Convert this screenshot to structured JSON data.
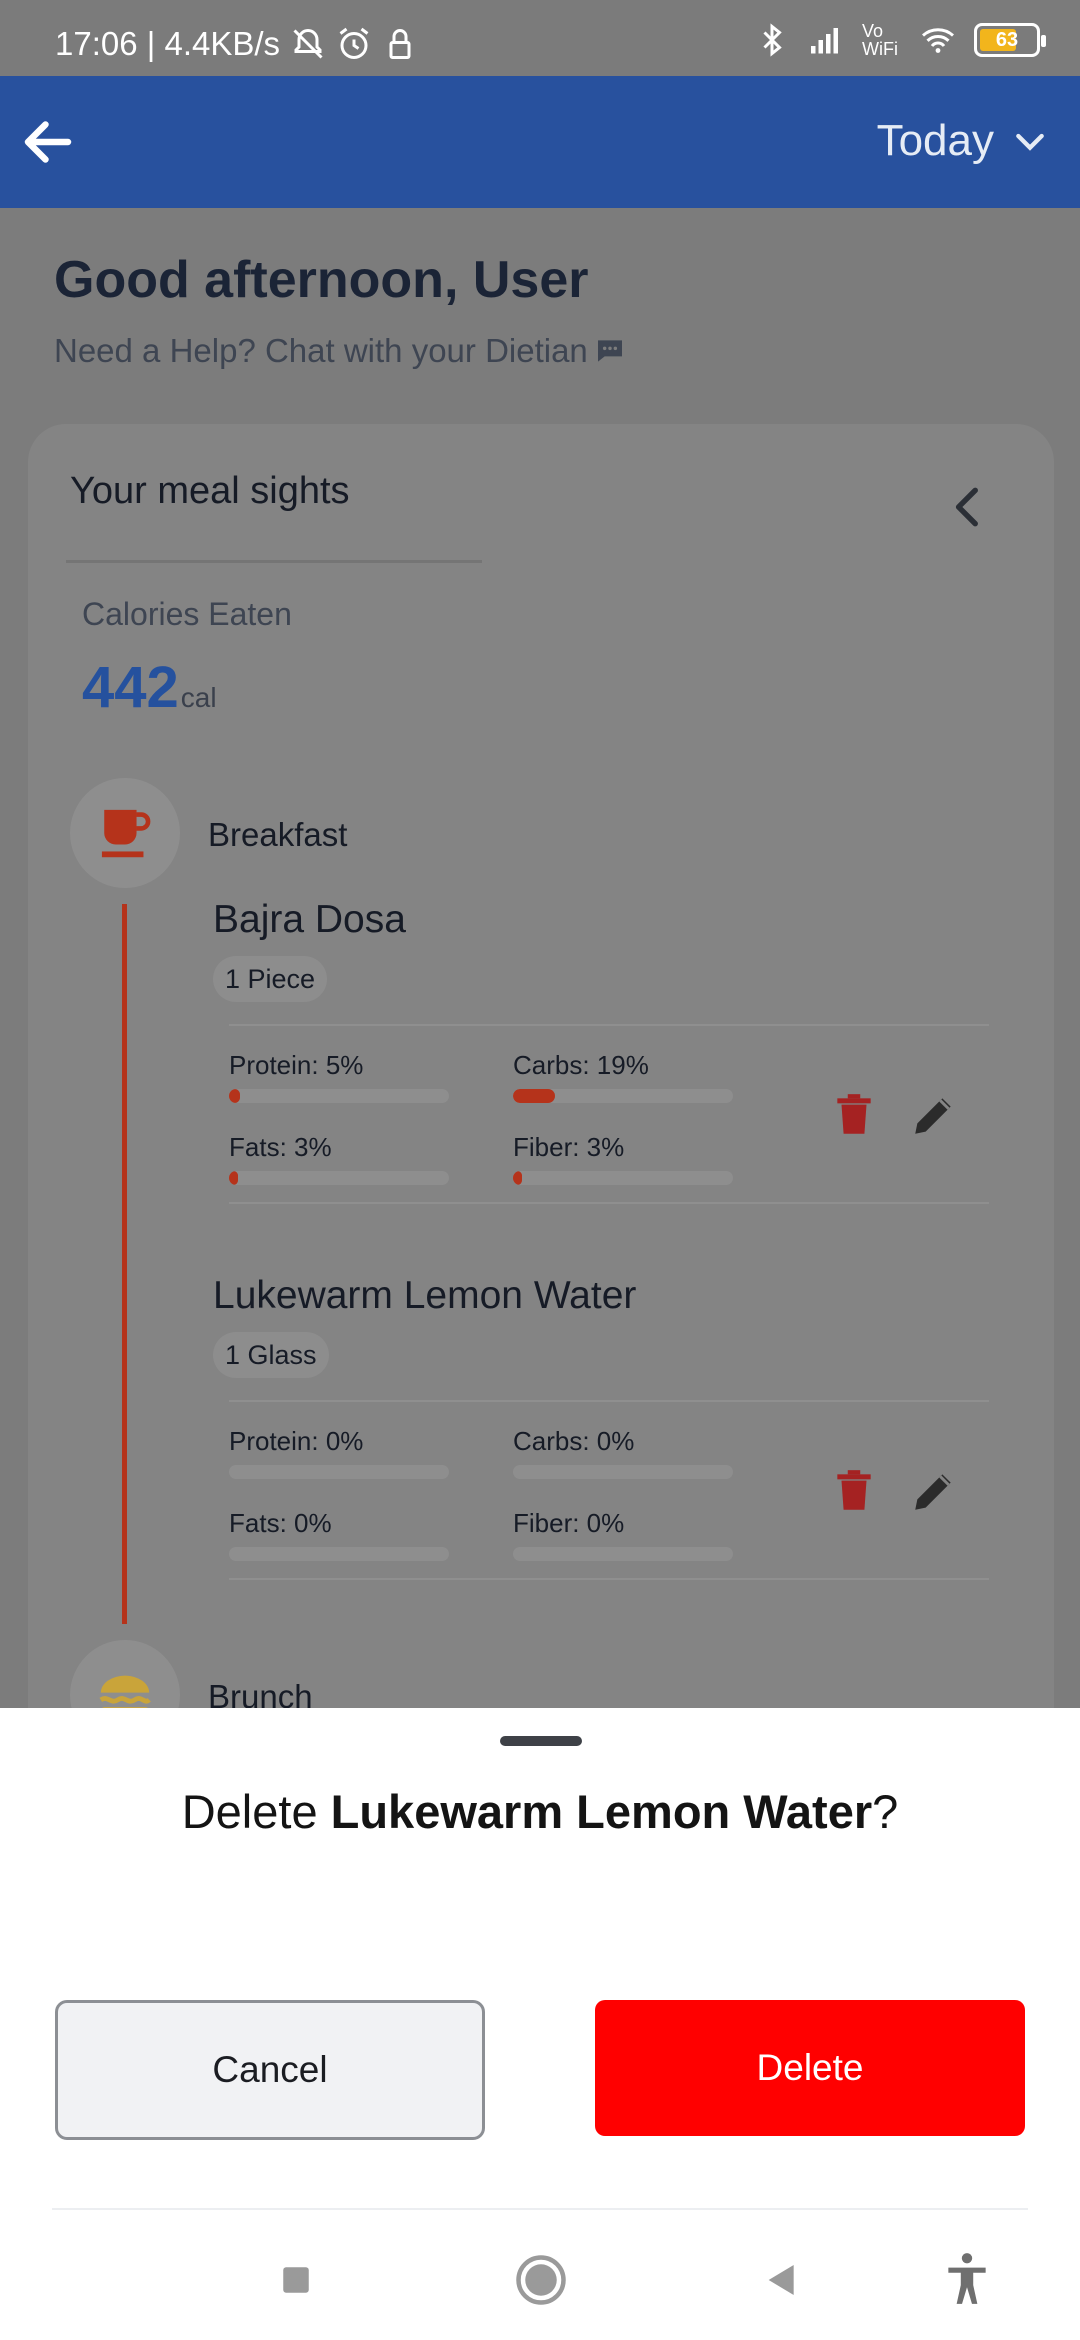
{
  "status_bar": {
    "time_speed": "17:06 | 4.4KB/s",
    "battery": "63",
    "network_label": "Vo WiFi"
  },
  "app_bar": {
    "date_filter": "Today"
  },
  "main": {
    "greeting": "Good afternoon, User",
    "help_text": "Need a Help? Chat with your Dietian"
  },
  "card": {
    "title": "Your meal sights",
    "calories_label": "Calories Eaten",
    "calories_value": "442",
    "calories_unit": "cal"
  },
  "meals": {
    "breakfast": {
      "name": "Breakfast",
      "foods": [
        {
          "title": "Bajra Dosa",
          "quantity": "1 Piece",
          "protein": {
            "label": "Protein: 5%",
            "value": 5
          },
          "carbs": {
            "label": "Carbs: 19%",
            "value": 19
          },
          "fats": {
            "label": "Fats: 3%",
            "value": 3
          },
          "fiber": {
            "label": "Fiber: 3%",
            "value": 3
          }
        },
        {
          "title": "Lukewarm Lemon Water",
          "quantity": "1 Glass",
          "protein": {
            "label": "Protein: 0%",
            "value": 0
          },
          "carbs": {
            "label": "Carbs: 0%",
            "value": 0
          },
          "fats": {
            "label": "Fats: 0%",
            "value": 0
          },
          "fiber": {
            "label": "Fiber: 0%",
            "value": 0
          }
        }
      ]
    },
    "brunch": {
      "name": "Brunch"
    }
  },
  "sheet": {
    "prefix": "Delete ",
    "item": "Lukewarm Lemon Water",
    "suffix": "?",
    "cancel_label": "Cancel",
    "delete_label": "Delete"
  },
  "colors": {
    "app_bar": "#28519e",
    "accent_red": "#b5331b",
    "delete_button": "#ff0000"
  }
}
